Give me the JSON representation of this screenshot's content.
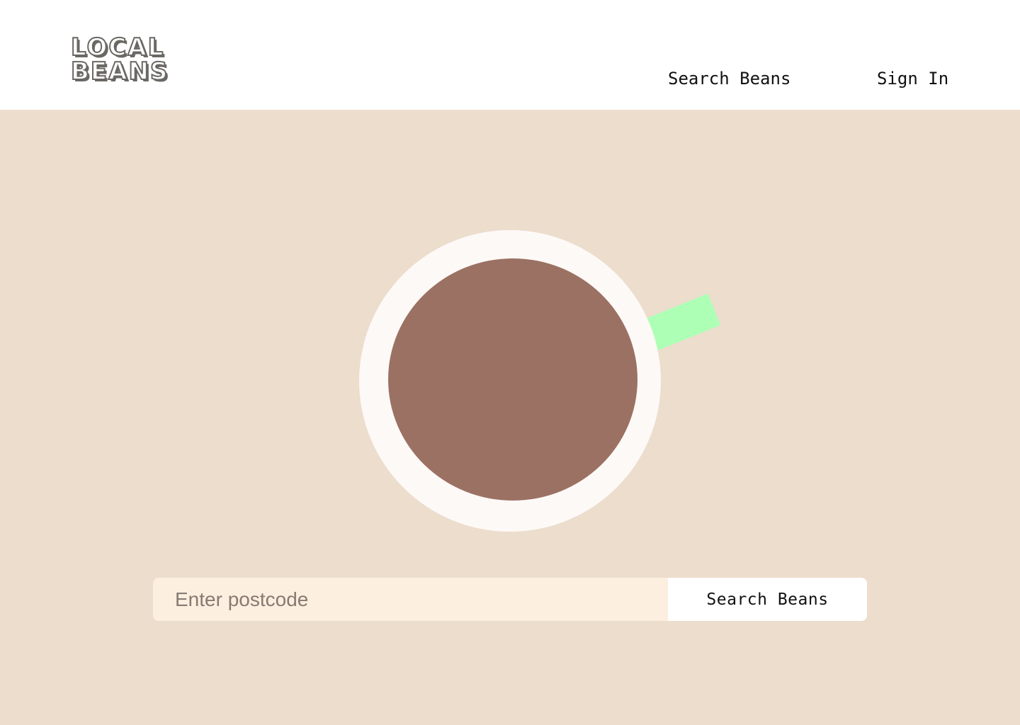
{
  "brand": {
    "line1": "LOCAL",
    "line2": "BEANS"
  },
  "nav": {
    "search_label": "Search Beans",
    "signin_label": "Sign In"
  },
  "search": {
    "placeholder": "Enter postcode",
    "value": "",
    "button_label": "Search Beans"
  },
  "illustration": {
    "icon": "coffee-cup-top-view-icon",
    "colors": {
      "background": "#ecddcd",
      "saucer": "#fdf9f6",
      "coffee": "#9b7163",
      "handle": "#adffb5"
    }
  }
}
